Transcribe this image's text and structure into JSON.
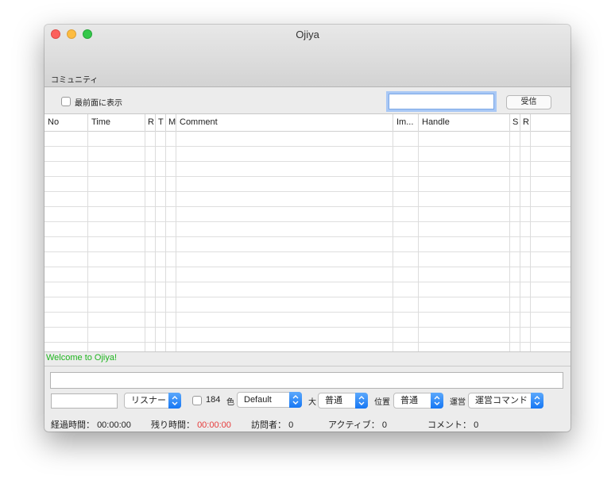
{
  "window": {
    "title": "Ojiya"
  },
  "toolbar": {
    "label": "コミュニティ"
  },
  "controls": {
    "always_on_top_label": "最前面に表示",
    "url_value": "",
    "receive_button": "受信"
  },
  "table": {
    "columns": [
      "No",
      "Time",
      "R",
      "T",
      "M",
      "Comment",
      "Im...",
      "Handle",
      "S",
      "R"
    ],
    "rows": []
  },
  "log": {
    "message": "Welcome to Ojiya!"
  },
  "composer": {
    "comment_value": "",
    "small_value": "",
    "user_type": "リスナー",
    "anon_label": "184",
    "color_label": "色",
    "color_value": "Default",
    "size_label": "大",
    "size_value": "普通",
    "position_label": "位置",
    "position_value": "普通",
    "admin_label": "運営",
    "admin_value": "運営コマンド"
  },
  "status": {
    "elapsed_label": "経過時間：",
    "elapsed_value": "00:00:00",
    "remaining_label": "残り時間：",
    "remaining_value": "00:00:00",
    "visitors_label": "訪問者：",
    "visitors_value": "0",
    "active_label": "アクティブ：",
    "active_value": "0",
    "comments_label": "コメント：",
    "comments_value": "0"
  },
  "colors": {
    "welcome_text": "#1fb51f",
    "remaining_time": "#e63a3a",
    "popup_accent": "#1677f4"
  }
}
